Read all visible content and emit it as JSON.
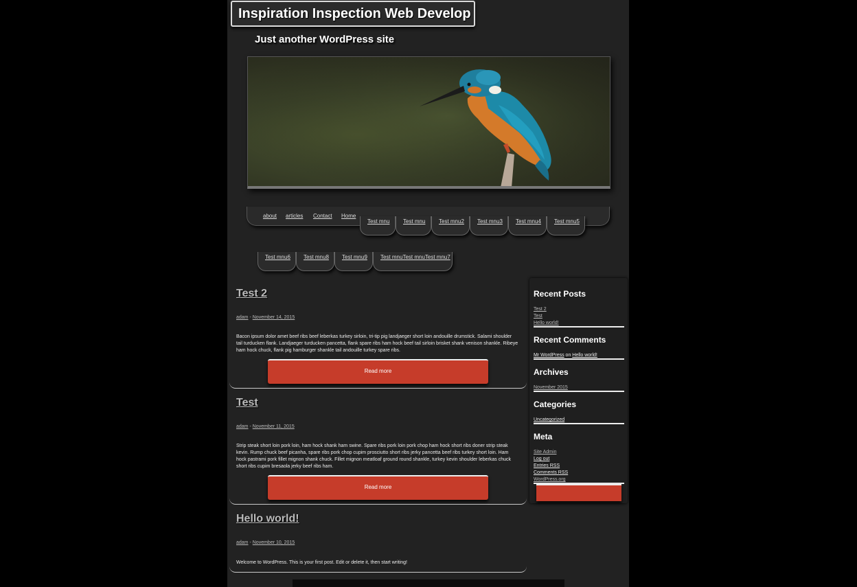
{
  "site": {
    "title": "Inspiration Inspection Web Develop",
    "tagline": "Just another WordPress site"
  },
  "nav": {
    "links": [
      "about",
      "articles",
      "Contact",
      "Home"
    ],
    "tabs_row1": [
      "Test mnu",
      "Test mnu",
      "Test mnu2",
      "Test mnu3",
      "Test mnu4",
      "Test mnu5"
    ],
    "tabs_row2": [
      "Test mnu6",
      "Test mnu8",
      "Test mnu9",
      "Test mnuTest mnuTest mnu7"
    ]
  },
  "posts": [
    {
      "title": "Test 2",
      "author": "adam",
      "separator": " - ",
      "date": "November 14, 2015",
      "excerpt": "Bacon ipsum dolor amet beef ribs beef leberkas turkey sirloin, tri-tip pig landjaeger short loin andouille drumstick. Salami shoulder tail turducken flank. Landjaeger turducken pancetta, flank spare ribs ham hock beef tail sirloin brisket shank venison shankle. Ribeye ham hock chuck, flank pig hamburger shankle tail andouille turkey spare ribs.",
      "read_more": "Read more"
    },
    {
      "title": "Test",
      "author": "adam",
      "separator": " - ",
      "date": "November 11, 2015",
      "excerpt": "Strip steak short loin pork loin, ham hock shank ham swine. Spare ribs pork loin pork chop ham hock short ribs doner strip steak kevin. Rump chuck beef picanha, spare ribs pork chop cupim prosciutto short ribs jerky pancetta beef ribs turkey short loin. Ham hock pastrami pork fillet mignon shank chuck. Fillet mignon meatloaf ground round shankle, turkey kevin shoulder leberkas chuck short ribs cupim bresaola jerky beef ribs ham.",
      "read_more": "Read more"
    },
    {
      "title": "Hello world!",
      "author": "adam",
      "separator": " - ",
      "date": "November 10, 2015",
      "excerpt": "Welcome to WordPress. This is your first post. Edit or delete it, then start writing!"
    }
  ],
  "sidebar": {
    "recent_posts": {
      "title": "Recent Posts",
      "items": [
        "Test 2",
        "Test",
        "Hello world!"
      ]
    },
    "recent_comments": {
      "title": "Recent Comments",
      "author": "Mr WordPress",
      "on": " on ",
      "post": "Hello world!"
    },
    "archives": {
      "title": "Archives",
      "items": [
        "November 2015"
      ]
    },
    "categories": {
      "title": "Categories",
      "items": [
        "Uncategorized"
      ]
    },
    "meta": {
      "title": "Meta",
      "items": [
        "Site Admin",
        "Log out",
        "Entries RSS",
        "Comments RSS",
        "WordPress.org"
      ]
    }
  }
}
